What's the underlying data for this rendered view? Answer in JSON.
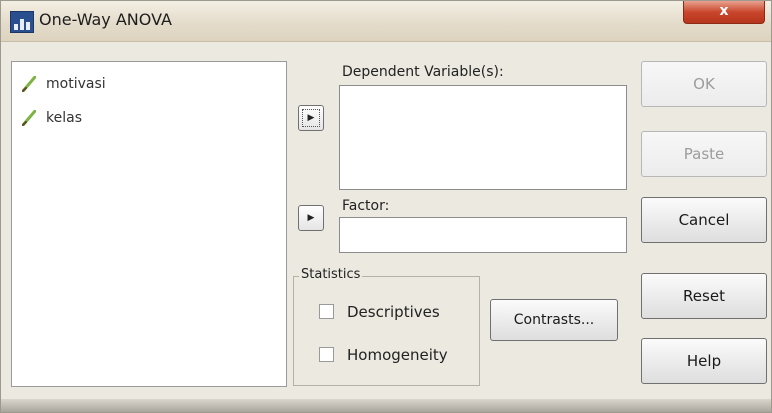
{
  "window": {
    "title": "One-Way ANOVA",
    "close_label": "x"
  },
  "variables": [
    {
      "name": "motivasi",
      "icon": "scale-variable-icon"
    },
    {
      "name": "kelas",
      "icon": "scale-variable-icon"
    }
  ],
  "dependent": {
    "label": "Dependent Variable(s):",
    "mnemonic": "V"
  },
  "factor": {
    "label": "Factor:",
    "mnemonic": "F"
  },
  "statistics": {
    "legend": "Statistics",
    "descriptives": {
      "label": "Descriptives",
      "checked": false
    },
    "homogeneity": {
      "label": "Homogeneity",
      "checked": false
    }
  },
  "buttons": {
    "ok": "OK",
    "paste": "Paste",
    "cancel": "Cancel",
    "reset": "Reset",
    "help": "Help",
    "contrasts": "Contrasts..."
  },
  "colors": {
    "accent_green": "#7cb342",
    "close_red": "#c9472c"
  }
}
